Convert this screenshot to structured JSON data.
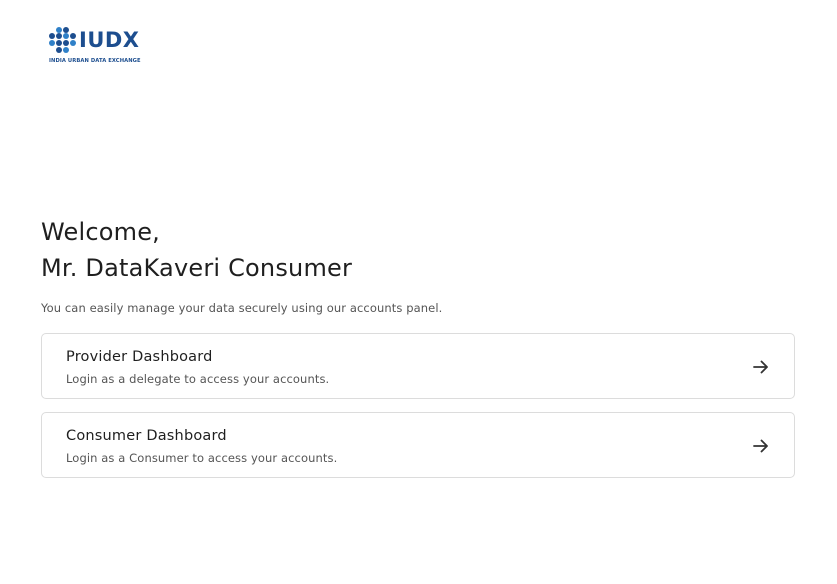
{
  "brand": {
    "name": "IUDX",
    "tagline": "INDIA URBAN DATA EXCHANGE",
    "logo_icon": "hexagon-cluster-logo-icon",
    "color": "#1d4e8f"
  },
  "welcome": {
    "line1": "Welcome,",
    "line2": "Mr. DataKaveri Consumer"
  },
  "intro": "You can easily manage your data securely using our accounts panel.",
  "cards": [
    {
      "title": "Provider Dashboard",
      "description": "Login as a delegate to access your accounts.",
      "icon": "arrow-right-icon"
    },
    {
      "title": "Consumer Dashboard",
      "description": "Login as a Consumer to access your accounts.",
      "icon": "arrow-right-icon"
    }
  ],
  "colors": {
    "text_primary": "#1f1f1f",
    "text_secondary": "#555555",
    "card_border": "#dcdcdc"
  }
}
